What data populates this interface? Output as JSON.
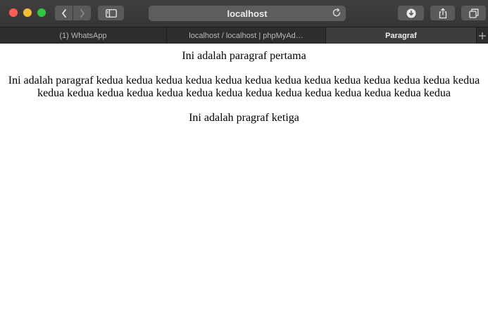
{
  "browser": {
    "address": "localhost",
    "tabs": [
      {
        "label": "(1) WhatsApp",
        "active": false
      },
      {
        "label": "localhost / localhost | phpMyAd…",
        "active": false
      },
      {
        "label": "Paragraf",
        "active": true
      }
    ],
    "colors": {
      "close": "#fd5d56",
      "minimize": "#f6bc33",
      "maximize": "#2ec83f"
    },
    "icons": {
      "back": "chevron-left-icon",
      "forward": "chevron-right-icon",
      "sidebar": "sidebar-icon",
      "reload": "reload-icon",
      "download": "download-icon",
      "share": "share-icon",
      "tabs": "tabs-overview-icon",
      "new_tab": "plus-icon"
    }
  },
  "page": {
    "paragraphs": [
      "Ini adalah paragraf pertama",
      "Ini adalah paragraf kedua kedua kedua kedua kedua kedua kedua kedua kedua kedua kedua kedua kedua kedua kedua kedua kedua kedua kedua kedua kedua kedua kedua kedua kedua kedua kedua",
      "Ini adalah pragraf ketiga"
    ]
  }
}
